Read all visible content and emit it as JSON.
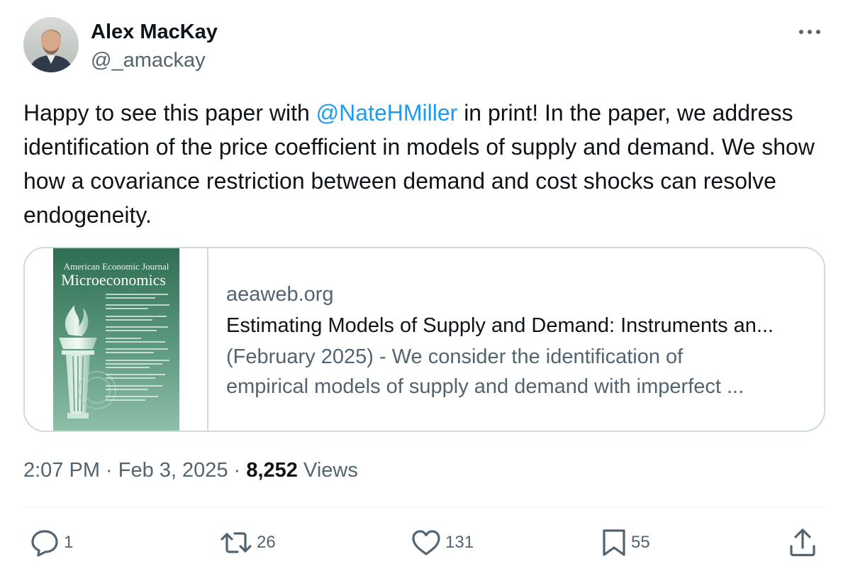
{
  "author": {
    "name": "Alex MacKay",
    "handle": "@_amackay"
  },
  "tweet": {
    "text_before": "Happy to see this paper with ",
    "mention": "@NateHMiller",
    "text_after": " in print!  In the paper, we address identification of the price coefficient in models of supply and demand. We show how a covariance restriction between demand and cost shocks can resolve endogeneity."
  },
  "card": {
    "cover_title_line1": "American Economic Journal",
    "cover_title_line2": "Microeconomics",
    "domain": "aeaweb.org",
    "title": "Estimating Models of Supply and Demand: Instruments an...",
    "desc_line1": "(February 2025) - We consider the identification of",
    "desc_line2": "empirical models of supply and demand with imperfect ..."
  },
  "meta": {
    "time": "2:07 PM",
    "sep1": " · ",
    "date": "Feb 3, 2025",
    "sep2": " · ",
    "views_count": "8,252",
    "views_label": " Views"
  },
  "actions": {
    "reply_count": "1",
    "retweet_count": "26",
    "like_count": "131",
    "bookmark_count": "55"
  },
  "icons": [
    "more-icon",
    "reply-icon",
    "retweet-icon",
    "like-icon",
    "bookmark-icon",
    "share-icon"
  ],
  "colors": {
    "mention": "#1d9bf0",
    "text": "#0f1419",
    "secondary": "#536471",
    "border": "#cfd9de"
  }
}
